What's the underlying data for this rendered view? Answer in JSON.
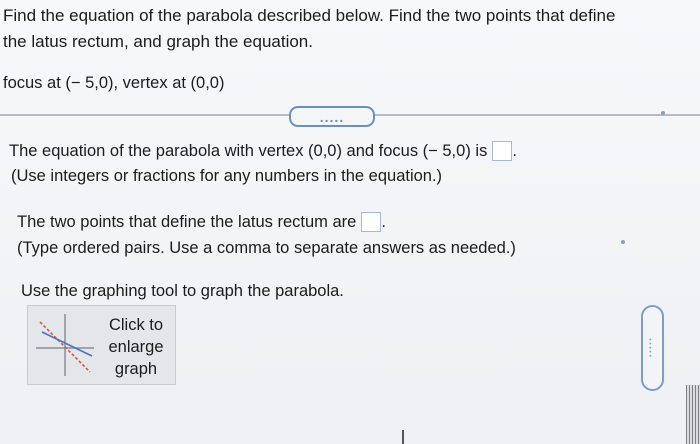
{
  "question": {
    "line1": "Find the equation of the parabola described below. Find the two points that define",
    "line2": "the latus rectum, and graph the equation.",
    "given": "focus at (− 5,0), vertex at (0,0)"
  },
  "expand_button": {
    "label": "....."
  },
  "part1": {
    "prompt": "The equation of the parabola with vertex (0,0) and focus (− 5,0) is",
    "answer": "",
    "suffix": ".",
    "instruction": "(Use integers or fractions for any numbers in the equation.)"
  },
  "part2": {
    "prompt": "The two points that define the latus rectum are",
    "answer": "",
    "suffix": ".",
    "instruction": "(Type ordered pairs. Use a comma to separate answers as needed.)"
  },
  "part3": {
    "prompt": "Use the graphing tool to graph the parabola."
  },
  "graph_button": {
    "label_line1": "Click to",
    "label_line2": "enlarge",
    "label_line3": "graph",
    "icon": "graph-thumbnail-icon"
  },
  "scroll_handle": {
    "label": "....."
  },
  "colors": {
    "accent": "#6d8fbc",
    "answer_box_border": "#a9b8cc",
    "text": "#1c1c1c",
    "thumb_red_line": "#d9534f",
    "thumb_blue_line": "#4f74b8"
  }
}
